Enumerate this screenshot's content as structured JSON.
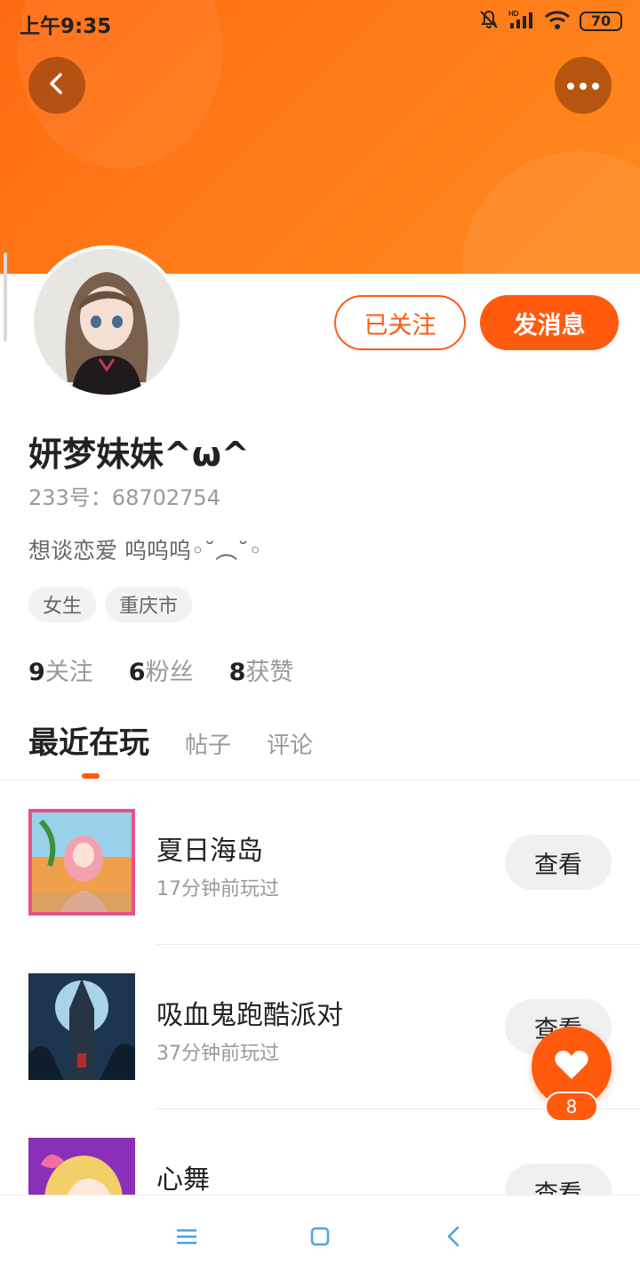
{
  "status_bar": {
    "time": "上午9:35",
    "battery": "70",
    "network": "HD"
  },
  "header": {
    "accent_color": "#ff6a12"
  },
  "profile": {
    "name": "妍梦妹妹^ω^",
    "id_text": "233号：68702754",
    "bio": "想谈恋爱  呜呜呜◦˘︵˘◦",
    "tags": [
      "女生",
      "重庆市"
    ],
    "follow_label": "已关注",
    "message_label": "发消息"
  },
  "stats": {
    "following_count": "9",
    "following_label": "关注",
    "fans_count": "6",
    "fans_label": "粉丝",
    "likes_count": "8",
    "likes_label": "获赞"
  },
  "tabs": [
    "最近在玩",
    "帖子",
    "评论"
  ],
  "games": [
    {
      "title": "夏日海岛",
      "subtitle": "17分钟前玩过",
      "button": "查看"
    },
    {
      "title": "吸血鬼跑酷派对",
      "subtitle": "37分钟前玩过",
      "button": "查看"
    },
    {
      "title": "心舞",
      "subtitle": "",
      "button": "查看"
    }
  ],
  "like_fab": {
    "count": "8"
  }
}
